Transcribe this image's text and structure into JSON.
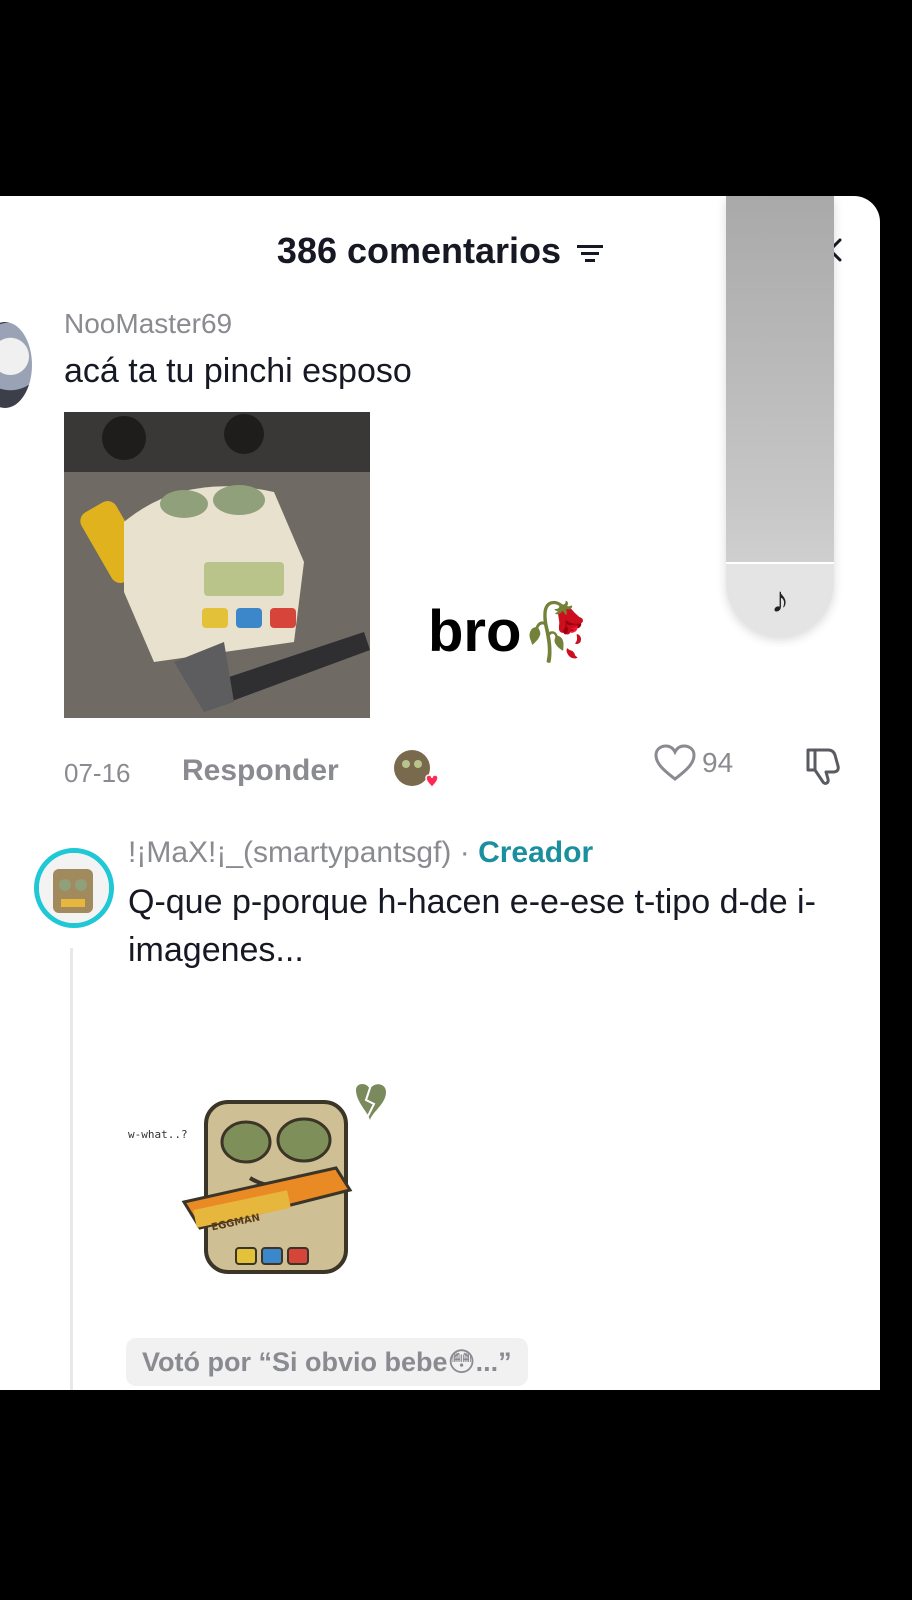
{
  "header": {
    "title": "386 comentarios",
    "sort_icon": "sort-lines-icon",
    "close_icon": "close-x-icon"
  },
  "music_overlay": {
    "icon": "music-note-icon",
    "glyph": "♪"
  },
  "comments": [
    {
      "username": "NooMaster69",
      "text": "acá ta tu pinchi esposo",
      "sticker_text": "bro",
      "sticker_emoji": "🥀",
      "date": "07-16",
      "reply_label": "Responder",
      "likes": "94"
    },
    {
      "username": "!¡MaX!¡_(smartypantsgf)",
      "separator": " · ",
      "badge": "Creador",
      "text": "Q-que p-porque h-hacen e-e-ese t-tipo d-de i-imagenes...",
      "sticker_caption": "w-what..?",
      "sticker_label": "EGGMAN",
      "vote_label": "Votó por “Si obvio bebe😳...”"
    }
  ],
  "colors": {
    "creator_ring": "#20c8d6",
    "creator_badge": "#1a8f9e",
    "muted_text": "#8a8b91",
    "like_heart_badge": "#fe2c55"
  }
}
